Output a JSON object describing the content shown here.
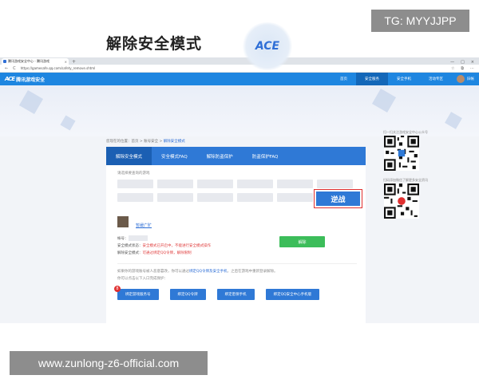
{
  "watermarks": {
    "top": "TG: MYYJJPP",
    "bottom": "www.zunlong-z6-official.com"
  },
  "browser": {
    "tab_title": "腾讯游戏安全中心 - 腾讯游戏",
    "tab_close": "×",
    "new_tab": "+",
    "url": "https://gamesafe.qq.com/safety_remove.shtml",
    "win_controls": [
      "—",
      "□",
      "×"
    ],
    "nav_back": "←",
    "nav_reload": "C"
  },
  "site": {
    "logo_mark": "ACE",
    "logo_text": "腾讯游戏安全",
    "nav": [
      "首页",
      "安全服务",
      "安全手机",
      "活动专区"
    ],
    "active_nav_index": 1,
    "username": "旧帐"
  },
  "hero": {
    "title": "解除安全模式",
    "emblem": "ACE"
  },
  "breadcrumb": {
    "prefix": "您现在的位置：首页 > 账号安全 > ",
    "current": "解除安全模式"
  },
  "panel": {
    "tabs": [
      "解除安全模式",
      "安全模式FAQ",
      "解除防盗保护",
      "防盗保护FAQ"
    ],
    "active_tab": 0,
    "hint": "请选择要查询的游戏",
    "highlighted_game": "逆战",
    "account_name": "暂缓广旷",
    "account_label": "帐号：",
    "safety_label": "安全模式状态：",
    "safety_value": "安全模式已开启中，不能进行安全模式操作",
    "release_label": "解除安全模式：",
    "release_value": "可通过绑定QQ令牌，解除限制",
    "release_button": "解除",
    "note_line1_prefix": "如果你的游戏账号被人恶意篡改，你可以通过",
    "note_link": "绑定QQ令牌及安全手机",
    "note_line1_suffix": "，之后在游戏中重新登录解除。",
    "note_line2": "你可以点击以下入口完成保护：",
    "actions": [
      "绑定游戏服务号",
      "绑定QQ令牌",
      "绑定密保手机",
      "绑定QQ安全中心手机版"
    ],
    "badge": "8"
  },
  "sidebar": {
    "qr1_caption": "扫一扫关注游戏安全中心公众号",
    "qr2_caption": "扫码添加微信了解更多安全资讯"
  }
}
